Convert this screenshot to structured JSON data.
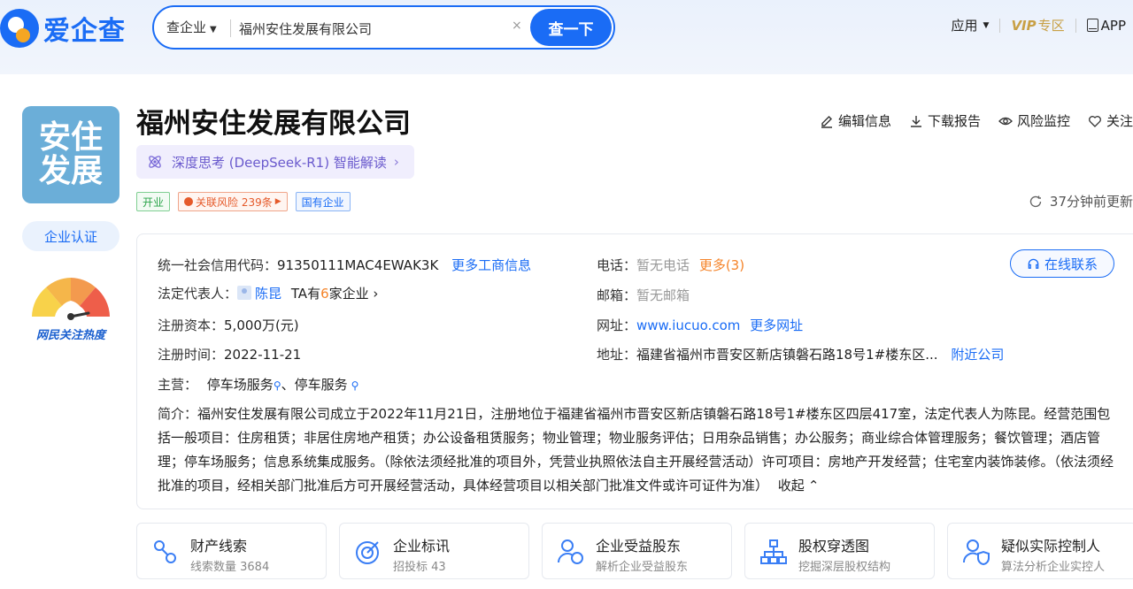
{
  "header": {
    "logo_text": "爱企查",
    "search": {
      "type_label": "查企业",
      "value": "福州安住发展有限公司",
      "clear": "×",
      "button": "查一下"
    },
    "nav": {
      "apps": "应用",
      "vip": "VIP",
      "vip_sub": "专区",
      "app": "APP"
    }
  },
  "company": {
    "logo_line1": "安住",
    "logo_line2": "发展",
    "name": "福州安住发展有限公司",
    "ai_label": "深度思考 (DeepSeek-R1) 智能解读",
    "tags": {
      "status": "开业",
      "risk": "关联风险 239条",
      "type": "国有企业"
    },
    "cert_button": "企业认证",
    "heat_label": "网民关注热度",
    "actions": {
      "edit": "编辑信息",
      "download": "下载报告",
      "monitor": "风险监控",
      "follow": "关注"
    },
    "updated": "37分钟前更新"
  },
  "info": {
    "credit_code_label": "统一社会信用代码：",
    "credit_code": "91350111MAC4EWAK3K",
    "more_business": "更多工商信息",
    "legal_rep_label": "法定代表人：",
    "legal_rep": "陈昆",
    "legal_rep_companies_pre": "TA有",
    "legal_rep_companies_num": "6",
    "legal_rep_companies_post": "家企业",
    "capital_label": "注册资本：",
    "capital": "5,000万(元)",
    "reg_date_label": "注册时间：",
    "reg_date": "2022-11-21",
    "business_label": "主营：",
    "business_1": "停车场服务",
    "business_sep": "、",
    "business_2": "停车服务",
    "phone_label": "电话：",
    "phone": "暂无电话",
    "phone_more": "更多(3)",
    "email_label": "邮箱：",
    "email": "暂无邮箱",
    "website_label": "网址：",
    "website": "www.iucuo.com",
    "website_more": "更多网址",
    "address_label": "地址：",
    "address": "福建省福州市晋安区新店镇磐石路18号1#楼东区...",
    "nearby": "附近公司",
    "online_contact": "在线联系",
    "desc_label": "简介：",
    "desc": "福州安住发展有限公司成立于2022年11月21日，注册地位于福建省福州市晋安区新店镇磐石路18号1#楼东区四层417室，法定代表人为陈昆。经营范围包括一般项目：住房租赁；非居住房地产租赁；办公设备租赁服务；物业管理；物业服务评估；日用杂品销售；办公服务；商业综合体管理服务；餐饮管理；酒店管理；停车场服务；信息系统集成服务。（除依法须经批准的项目外，凭营业执照依法自主开展经营活动）许可项目：房地产开发经营；住宅室内装饰装修。（依法须经批准的项目，经相关部门批准后方可开展经营活动，具体经营项目以相关部门批准文件或许可证件为准）",
    "collapse": "收起"
  },
  "tiles": [
    {
      "title": "财产线索",
      "sub": "线索数量 3684",
      "icon": "property-clue-icon"
    },
    {
      "title": "企业标讯",
      "sub": "招投标 43",
      "icon": "bid-target-icon"
    },
    {
      "title": "企业受益股东",
      "sub": "解析企业受益股东",
      "icon": "beneficiary-icon"
    },
    {
      "title": "股权穿透图",
      "sub": "挖掘深层股权结构",
      "icon": "equity-tree-icon"
    },
    {
      "title": "疑似实际控制人",
      "sub": "算法分析企业实控人",
      "icon": "controller-icon"
    }
  ],
  "colors": {
    "brand": "#1a6cf5",
    "vip": "#c8a046",
    "orange": "#f5842a",
    "green": "#2ba44a",
    "risk": "#e55a2b"
  }
}
